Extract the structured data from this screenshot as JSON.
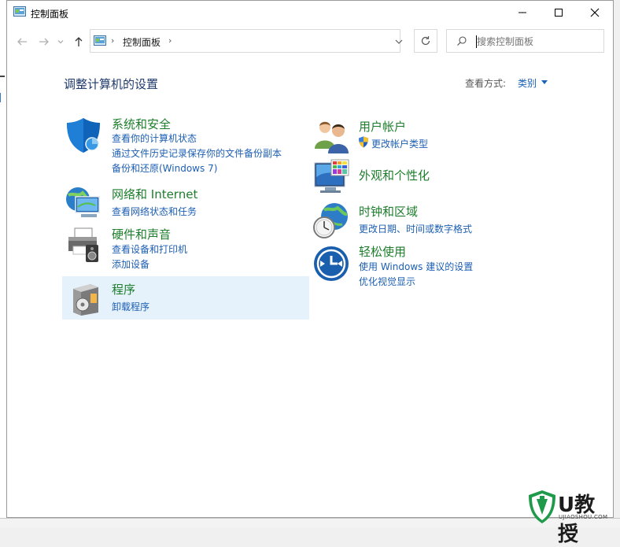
{
  "window": {
    "title": "控制面板",
    "controls": {
      "minimize": "minimize",
      "maximize": "maximize",
      "close": "close"
    }
  },
  "nav": {
    "breadcrumb": [
      "控制面板"
    ],
    "search": {
      "placeholder": "搜索控制面板",
      "value": ""
    }
  },
  "main": {
    "heading": "调整计算机的设置",
    "view_by_label": "查看方式:",
    "view_by_value": "类别"
  },
  "categories": {
    "system": {
      "title": "系统和安全",
      "links": [
        "查看你的计算机状态",
        "通过文件历史记录保存你的文件备份副本",
        "备份和还原(Windows 7)"
      ]
    },
    "network": {
      "title": "网络和 Internet",
      "links": [
        "查看网络状态和任务"
      ]
    },
    "hardware": {
      "title": "硬件和声音",
      "links": [
        "查看设备和打印机",
        "添加设备"
      ]
    },
    "programs": {
      "title": "程序",
      "links": [
        "卸载程序"
      ]
    },
    "accounts": {
      "title": "用户帐户",
      "links": [
        "更改帐户类型"
      ]
    },
    "appearance": {
      "title": "外观和个性化",
      "links": []
    },
    "clock": {
      "title": "时钟和区域",
      "links": [
        "更改日期、时间或数字格式"
      ]
    },
    "ease": {
      "title": "轻松使用",
      "links": [
        "使用 Windows 建议的设置",
        "优化视觉显示"
      ]
    }
  },
  "watermark": {
    "brand": "U教授",
    "url": "UJIAOSHOU.COM"
  },
  "colors": {
    "title_green": "#1c7e2b",
    "link_blue": "#1d5fb3",
    "highlight": "#e5f1fb"
  }
}
